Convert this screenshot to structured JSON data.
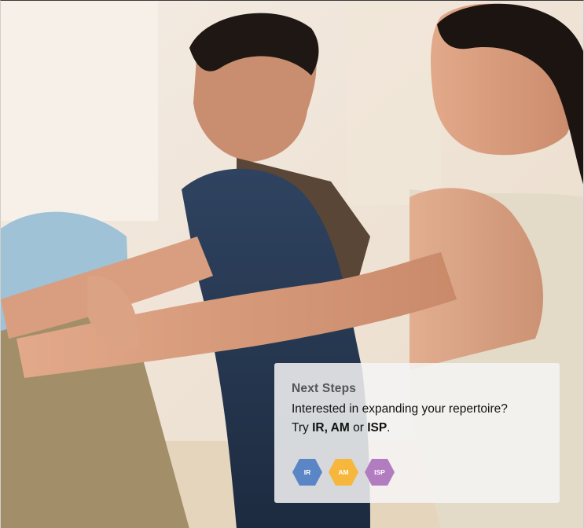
{
  "next_steps": {
    "title": "Next Steps",
    "line1": "Interested in expanding your repertoire?",
    "try_prefix": "Try ",
    "try_bold": "IR, AM",
    "try_middle": " or ",
    "try_bold2": "ISP",
    "try_suffix": "."
  },
  "badges": [
    {
      "label": "IR",
      "color": "#5b86c5"
    },
    {
      "label": "AM",
      "color": "#f6b73c"
    },
    {
      "label": "ISP",
      "color": "#b27cc0"
    }
  ]
}
